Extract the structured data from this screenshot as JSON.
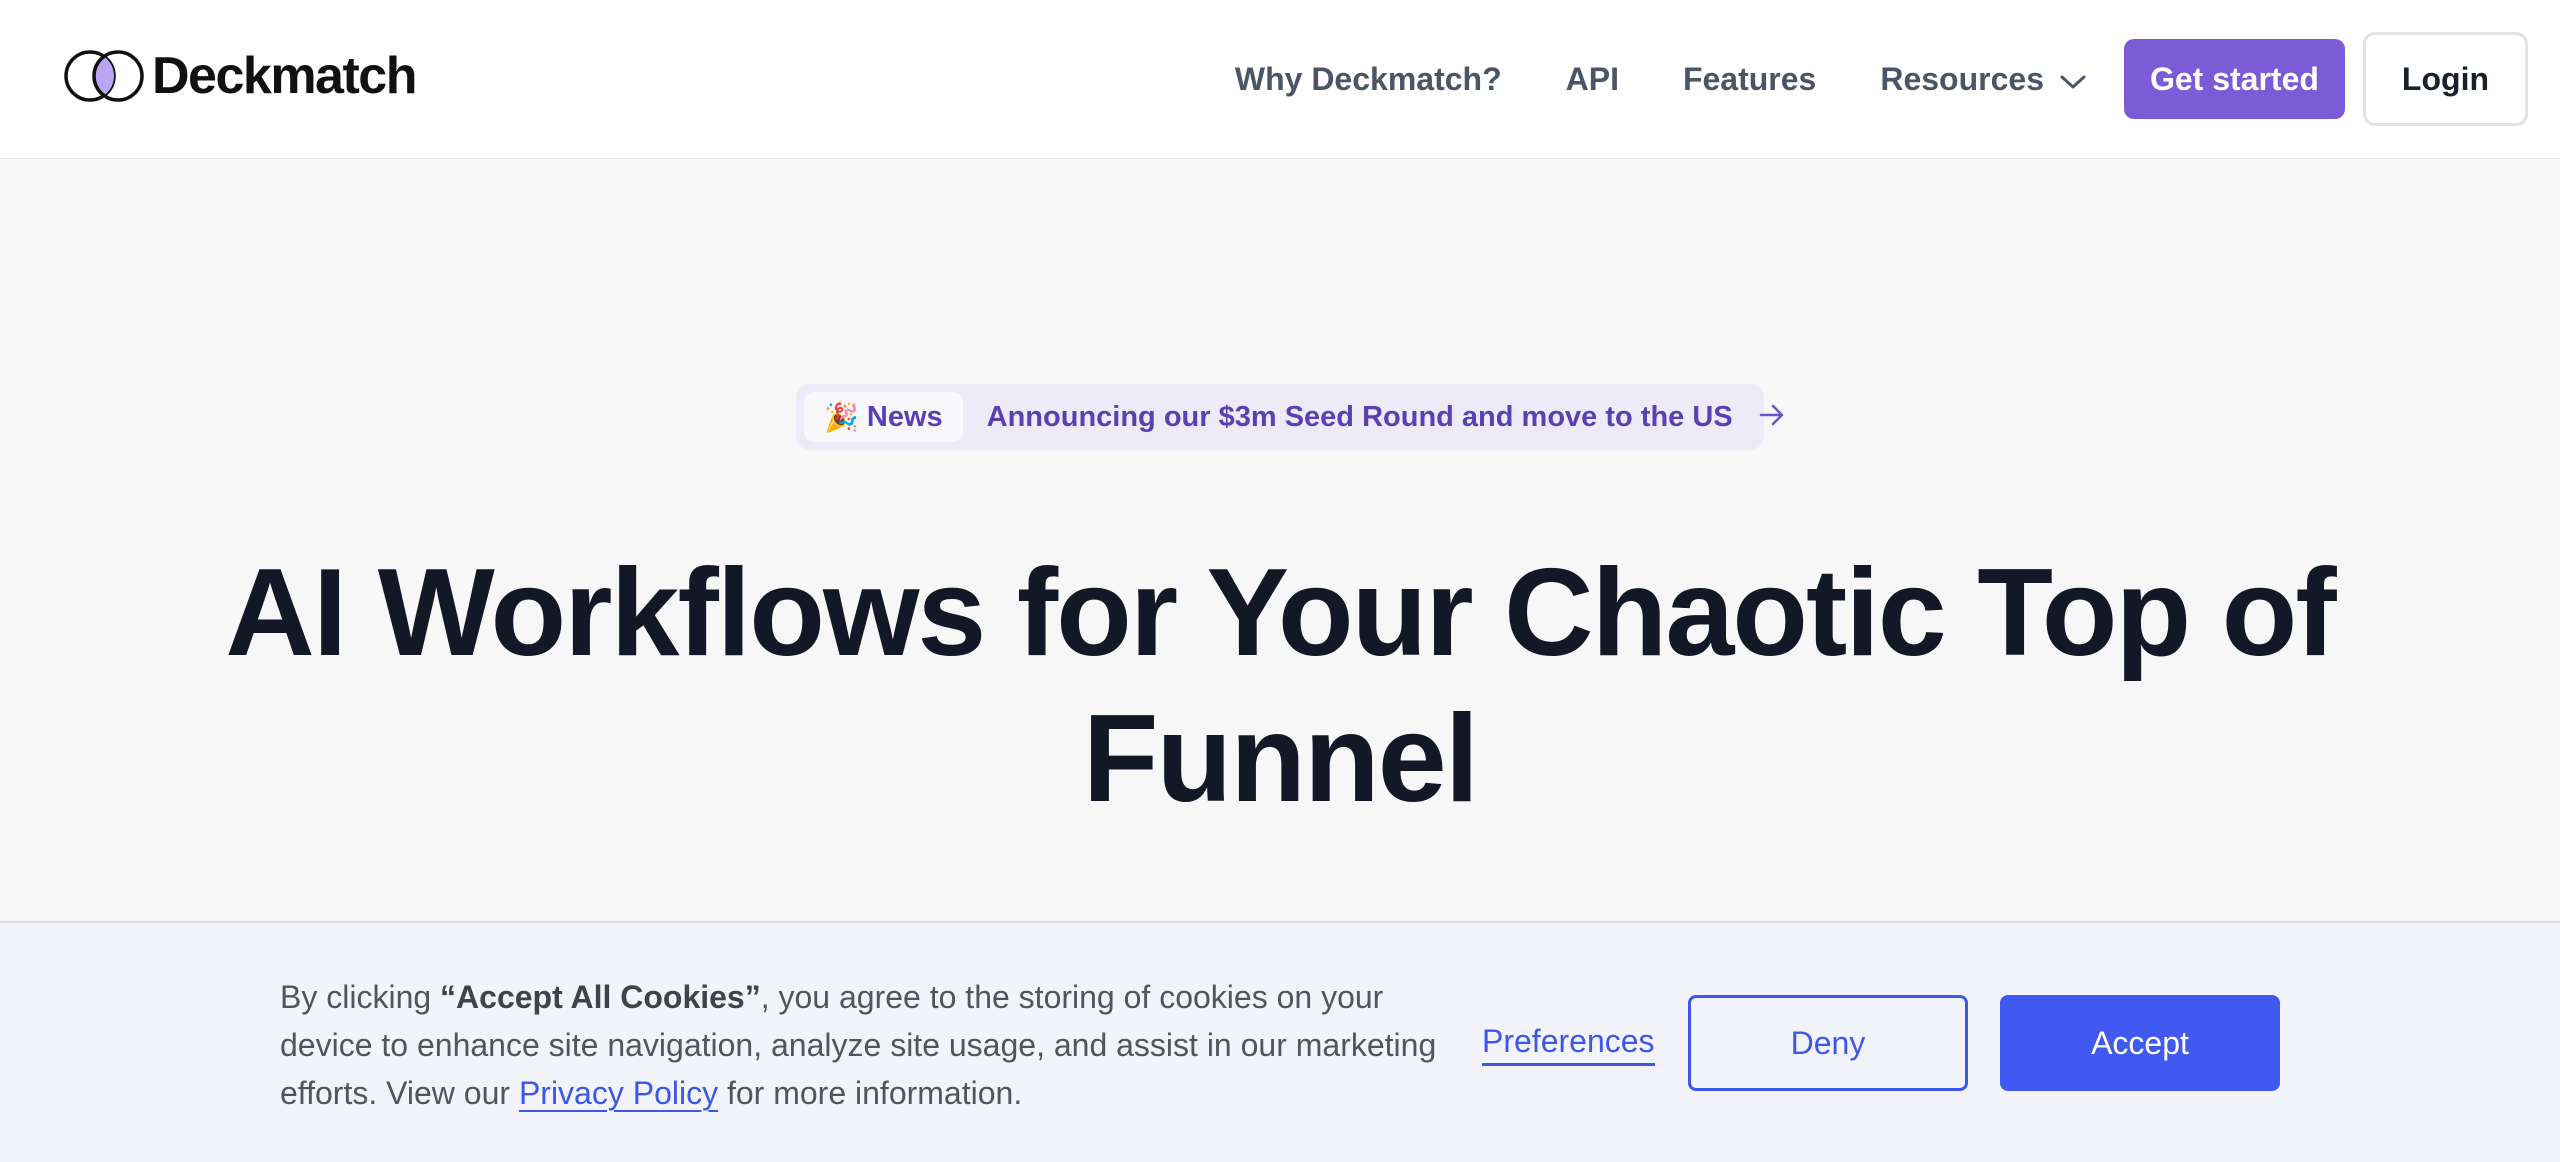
{
  "header": {
    "brand": "Deckmatch",
    "nav": {
      "why": "Why Deckmatch?",
      "api": "API",
      "features": "Features",
      "resources": "Resources",
      "get_started": "Get started",
      "login": "Login"
    }
  },
  "news": {
    "tag_emoji": "🎉",
    "tag": "News",
    "text": "Announcing our $3m Seed Round and move to the US"
  },
  "hero": {
    "title": "AI Workflows for Your Chaotic Top of Funnel"
  },
  "cookie": {
    "text_before": "By clicking ",
    "bold": "“Accept All Cookies”",
    "text_middle": ", you agree to the storing of cookies on your device to enhance site navigation, analyze site usage, and assist in our marketing efforts. View our ",
    "privacy_link": "Privacy Policy",
    "text_after": " for more information.",
    "preferences": "Preferences",
    "deny": "Deny",
    "accept": "Accept"
  },
  "colors": {
    "brand_purple": "#7b5cd6",
    "accent_blue": "#4159f0",
    "news_text": "#5b40b5",
    "heading": "#121826"
  }
}
